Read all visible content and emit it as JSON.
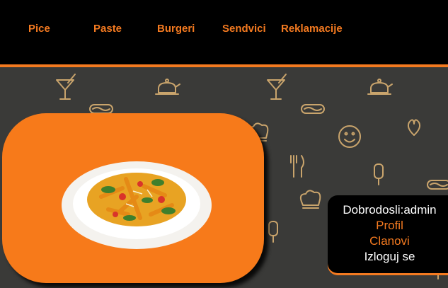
{
  "nav": {
    "items": [
      {
        "label": "Pice"
      },
      {
        "label": "Paste"
      },
      {
        "label": "Burgeri"
      },
      {
        "label": "Sendvici"
      },
      {
        "label": "Reklamacije"
      }
    ]
  },
  "user_panel": {
    "greeting": "Dobrodosli:admin",
    "profile_link": "Profil",
    "members_link": "Clanovi",
    "logout_link": "Izloguj se"
  },
  "colors": {
    "accent": "#f47a20",
    "nav_background": "#000000",
    "pattern_background": "#3a3a38",
    "hero_background": "#f77a1a",
    "icon_stroke": "#c9a46c"
  },
  "pattern_icons": [
    "cocktail-icon",
    "teapot-icon",
    "hotdog-icon",
    "smiley-icon",
    "heart-icon",
    "chef-hat-icon",
    "fork-knife-icon",
    "popsicle-icon"
  ],
  "hero": {
    "image": "pasta-dish"
  }
}
